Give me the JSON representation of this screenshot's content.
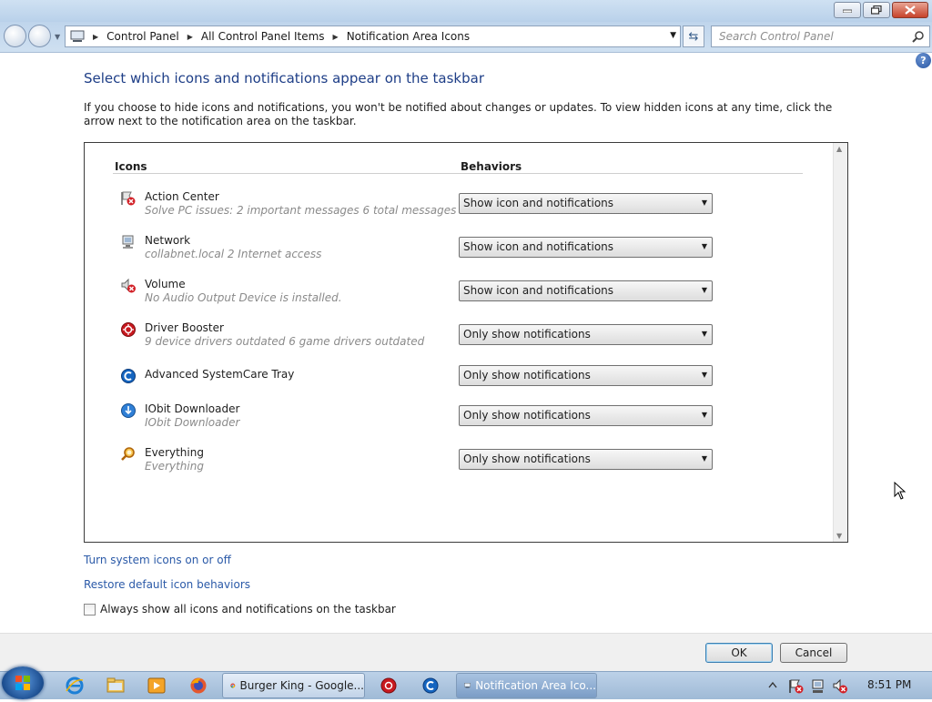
{
  "window": {
    "breadcrumbs": [
      "Control Panel",
      "All Control Panel Items",
      "Notification Area Icons"
    ],
    "search_placeholder": "Search Control Panel"
  },
  "main": {
    "heading": "Select which icons and notifications appear on the taskbar",
    "description": "If you choose to hide icons and notifications, you won't be notified about changes or updates. To view hidden icons at any time, click the arrow next to the notification area on the taskbar.",
    "col_icons": "Icons",
    "col_behaviors": "Behaviors",
    "rows": [
      {
        "name": "Action Center",
        "sub": "Solve PC issues: 2 important messages  6 total messages",
        "behavior": "Show icon and notifications",
        "icon": "action-center-flag-icon"
      },
      {
        "name": "Network",
        "sub": "collabnet.local  2 Internet access",
        "behavior": "Show icon and notifications",
        "icon": "network-icon"
      },
      {
        "name": "Volume",
        "sub": "No Audio Output Device is installed.",
        "behavior": "Show icon and notifications",
        "icon": "volume-icon"
      },
      {
        "name": "Driver Booster",
        "sub": "9 device drivers outdated  6 game drivers outdated",
        "behavior": "Only show notifications",
        "icon": "driver-booster-icon"
      },
      {
        "name": "Advanced SystemCare Tray",
        "sub": "",
        "behavior": "Only show notifications",
        "icon": "advanced-systemcare-icon"
      },
      {
        "name": "IObit Downloader",
        "sub": "IObit Downloader",
        "behavior": "Only show notifications",
        "icon": "iobit-downloader-icon"
      },
      {
        "name": "Everything",
        "sub": "Everything",
        "behavior": "Only show notifications",
        "icon": "everything-search-icon"
      }
    ],
    "link_system_icons": "Turn system icons on or off",
    "link_restore": "Restore default icon behaviors",
    "checkbox_label": "Always show all icons and notifications on the taskbar",
    "checkbox_checked": false
  },
  "footer": {
    "ok": "OK",
    "cancel": "Cancel"
  },
  "taskbar": {
    "items": [
      "Burger King - Google...",
      "Notification Area Ico..."
    ],
    "clock": "8:51 PM"
  },
  "colors": {
    "heading": "#1e3e87",
    "link": "#2b5aa8",
    "taskbar": "#9fbad6"
  }
}
